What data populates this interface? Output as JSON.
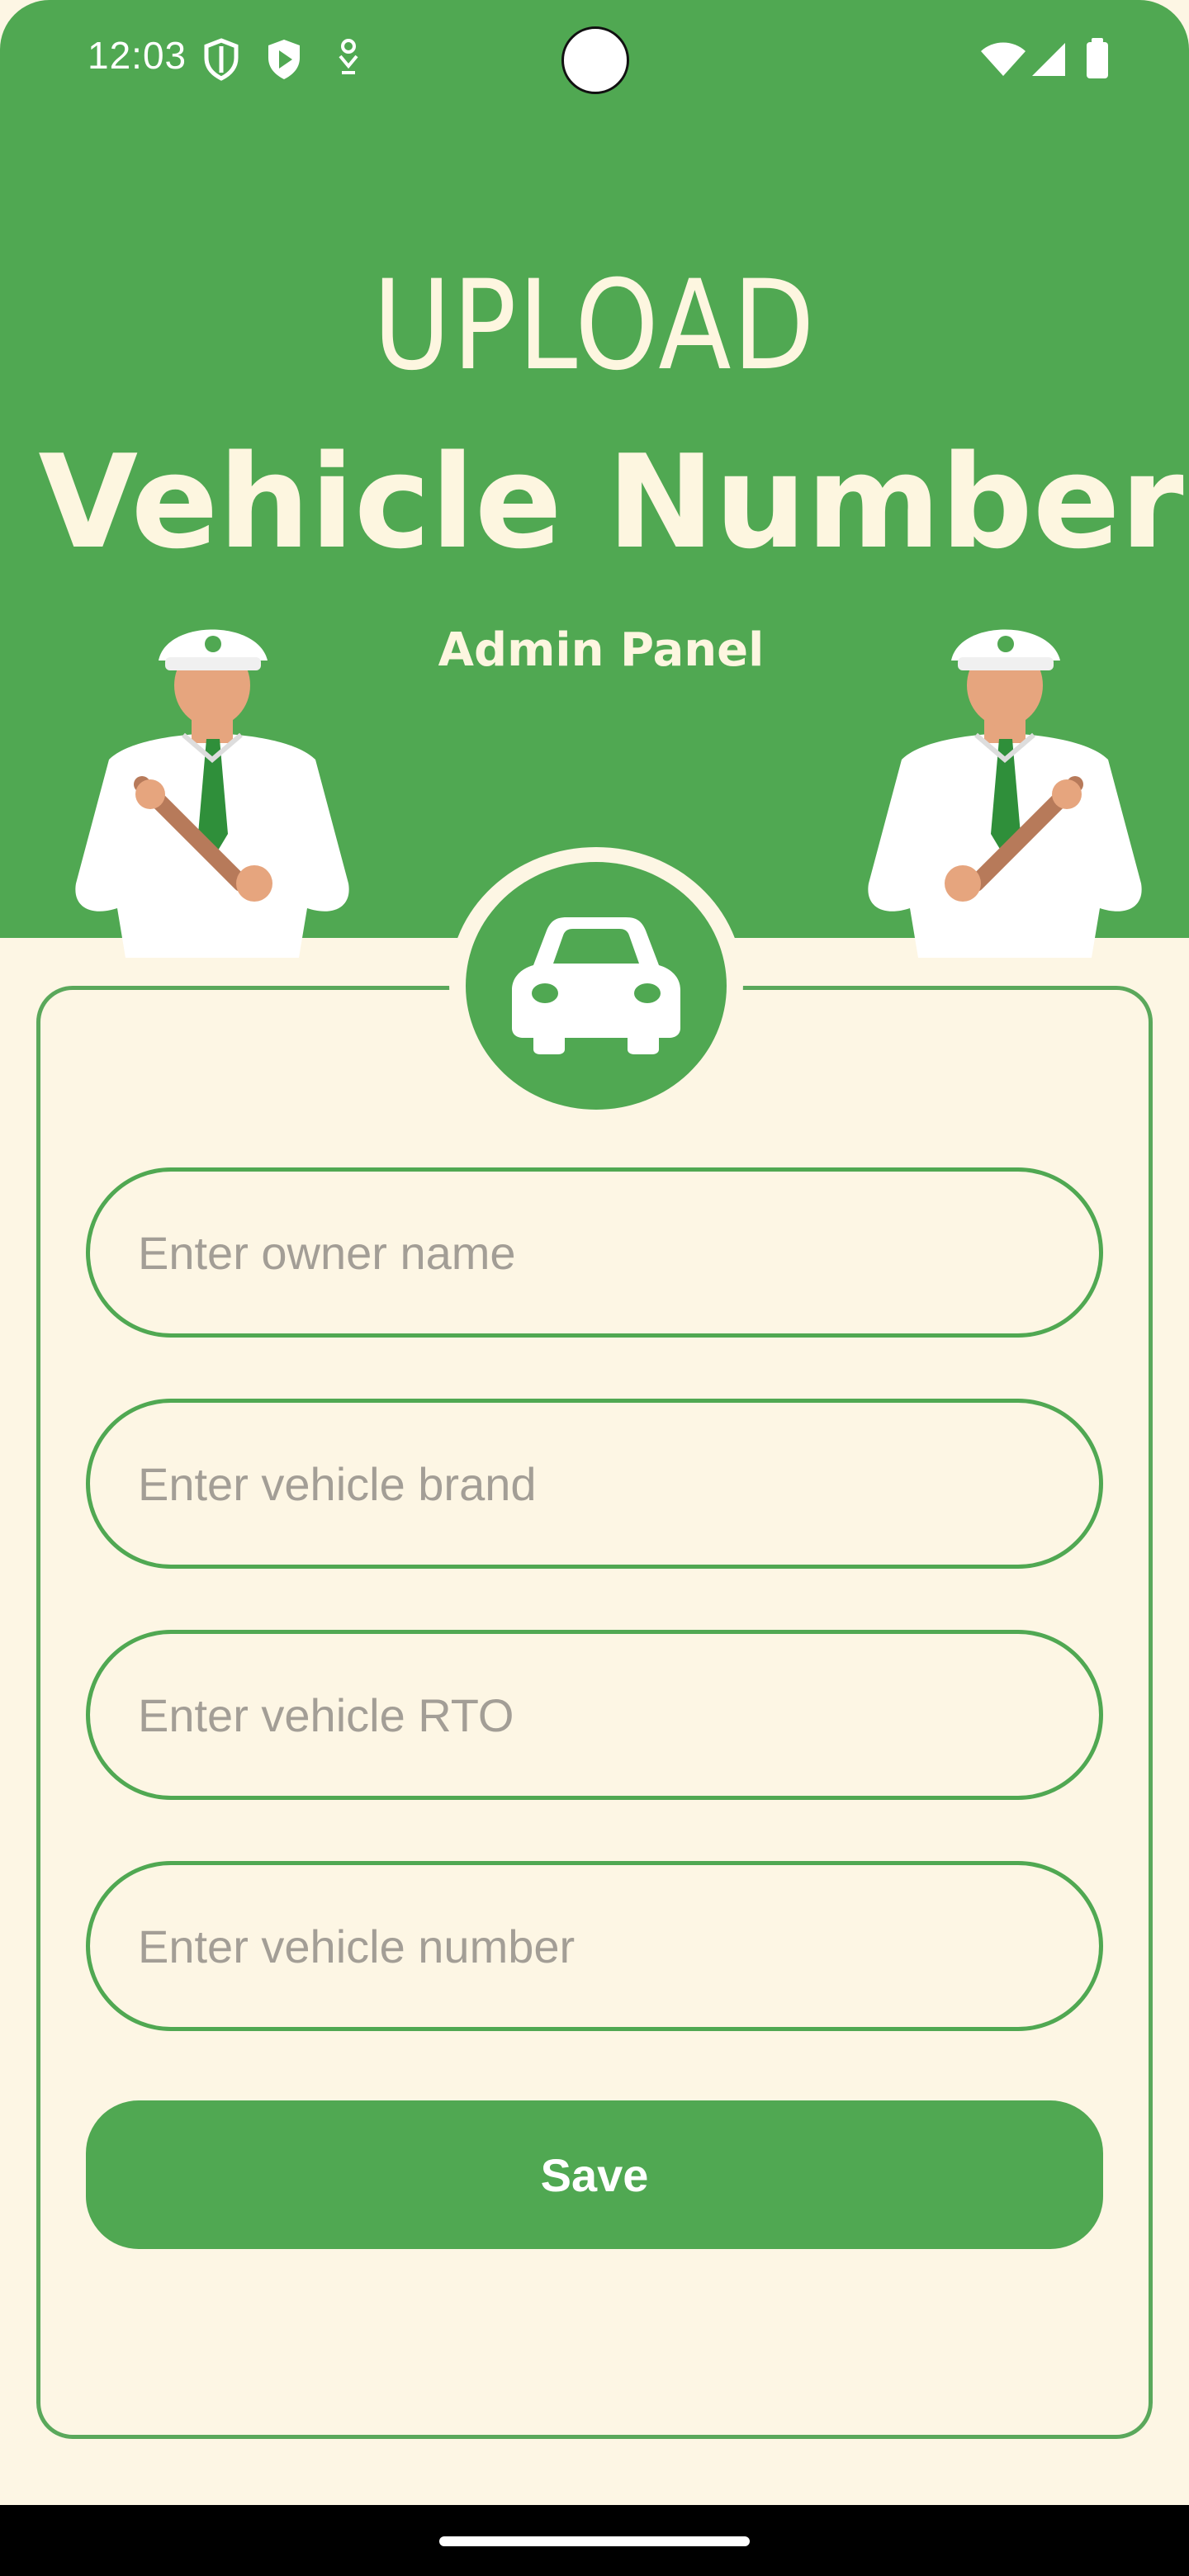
{
  "status_bar": {
    "time": "12:03"
  },
  "header": {
    "title_line1": "UPLOAD",
    "title_line2": "Vehicle Number",
    "subtitle": "Admin Panel"
  },
  "form": {
    "owner_name": {
      "value": "",
      "placeholder": "Enter owner name"
    },
    "vehicle_brand": {
      "value": "",
      "placeholder": "Enter vehicle brand"
    },
    "vehicle_rto": {
      "value": "",
      "placeholder": "Enter vehicle RTO"
    },
    "vehicle_number": {
      "value": "",
      "placeholder": "Enter vehicle number"
    },
    "save_label": "Save"
  },
  "icons": {
    "badge": "car-icon",
    "status": [
      "shield-icon",
      "play-protect-icon",
      "location-pin-icon",
      "wifi-icon",
      "signal-icon",
      "battery-icon"
    ]
  },
  "colors": {
    "brand_green": "#50a852",
    "background": "#fdf6e4",
    "title_text": "#fdf6e0",
    "placeholder": "#a39e96"
  }
}
